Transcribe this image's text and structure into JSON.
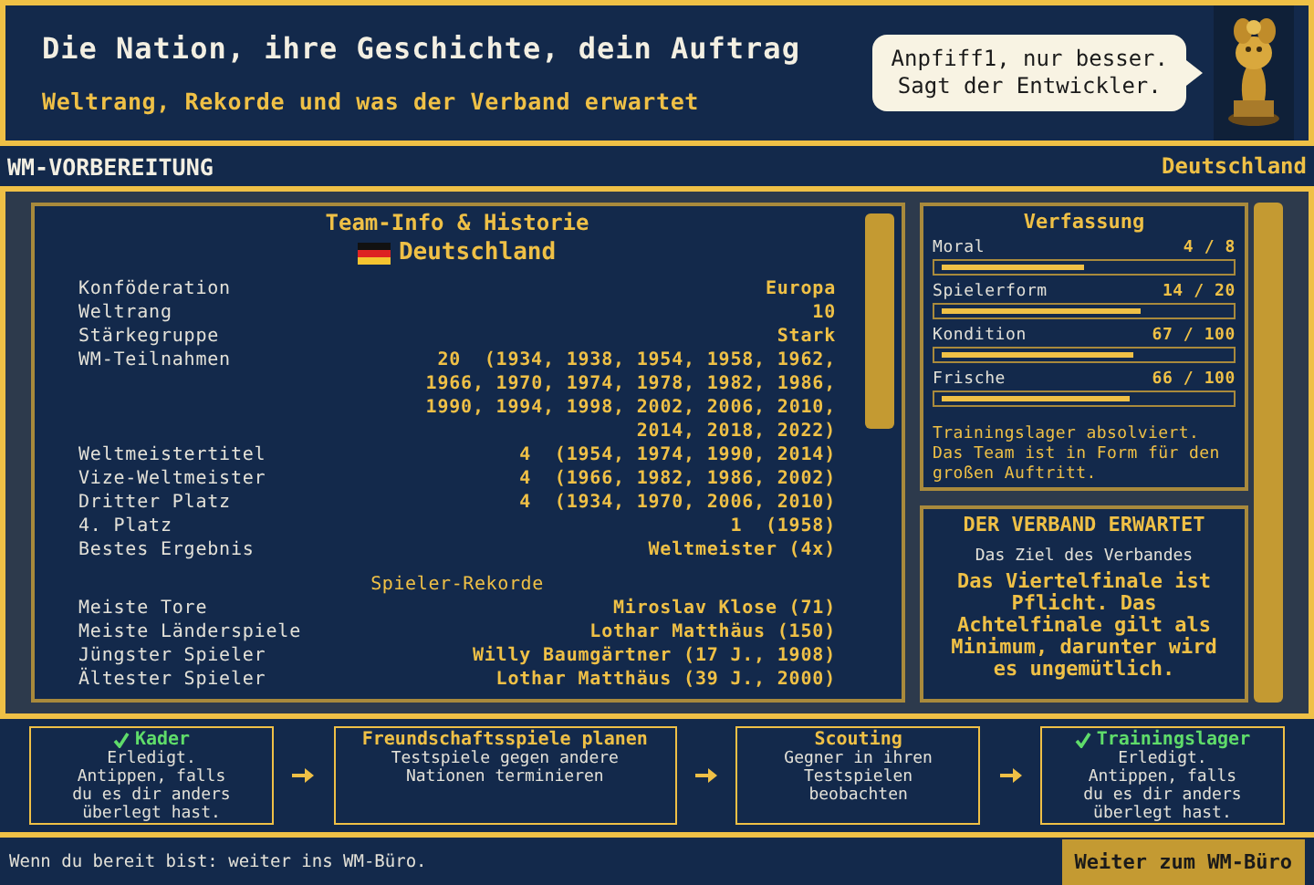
{
  "header": {
    "title": "Die Nation, ihre Geschichte, dein Auftrag",
    "subtitle": "Weltrang, Rekorde und was der Verband erwartet",
    "speech_bubble": "Anpfiff1, nur besser.\nSagt der Entwickler."
  },
  "title_bar": {
    "title": "WM-VORBEREITUNG",
    "country": "Deutschland"
  },
  "team_info": {
    "title": "Team-Info & Historie",
    "country": "Deutschland",
    "rows": [
      {
        "label": "Konföderation",
        "value": "Europa"
      },
      {
        "label": "Weltrang",
        "value": "10"
      },
      {
        "label": "Stärkegruppe",
        "value": "Stark"
      },
      {
        "label": "WM-Teilnahmen",
        "value": "20  (1934, 1938, 1954, 1958, 1962,\n1966, 1970, 1974, 1978, 1982, 1986,\n1990, 1994, 1998, 2002, 2006, 2010,\n2014, 2018, 2022)"
      },
      {
        "label": "Weltmeistertitel",
        "value": "4  (1954, 1974, 1990, 2014)"
      },
      {
        "label": "Vize-Weltmeister",
        "value": "4  (1966, 1982, 1986, 2002)"
      },
      {
        "label": "Dritter Platz",
        "value": "4  (1934, 1970, 2006, 2010)"
      },
      {
        "label": "4. Platz",
        "value": "1  (1958)"
      },
      {
        "label": "Bestes Ergebnis",
        "value": "Weltmeister (4x)"
      }
    ],
    "records_title": "Spieler-Rekorde",
    "records": [
      {
        "label": "Meiste Tore",
        "value": "Miroslav Klose (71)"
      },
      {
        "label": "Meiste Länderspiele",
        "value": "Lothar Matthäus (150)"
      },
      {
        "label": "Jüngster Spieler",
        "value": "Willy Baumgärtner (17 J., 1908)"
      },
      {
        "label": "Ältester Spieler",
        "value": "Lothar Matthäus (39 J., 2000)"
      }
    ]
  },
  "condition": {
    "title": "Verfassung",
    "meters": [
      {
        "name": "Moral",
        "reading": "4 / 8",
        "level": 0.5
      },
      {
        "name": "Spielerform",
        "reading": "14 / 20",
        "level": 0.7
      },
      {
        "name": "Kondition",
        "reading": "67 / 100",
        "level": 0.67
      },
      {
        "name": "Frische",
        "reading": "66 / 100",
        "level": 0.66
      }
    ],
    "note": "Trainingslager absolviert. Das Team ist in Form für den großen Auftritt."
  },
  "expectation": {
    "title": "DER VERBAND ERWARTET",
    "subtitle": "Das Ziel des Verbandes",
    "text": "Das Viertelfinale ist Pflicht. Das Achtelfinale gilt als Minimum, darunter wird es ungemütlich."
  },
  "steps": [
    {
      "title": "Kader",
      "text": "Erledigt.\nAntippen, falls\ndu es dir anders\nüberlegt hast.",
      "done": true
    },
    {
      "title": "Freundschaftsspiele planen",
      "text": "Testspiele gegen andere\nNationen terminieren",
      "done": false
    },
    {
      "title": "Scouting",
      "text": "Gegner in ihren\nTestspielen\nbeobachten",
      "done": false
    },
    {
      "title": "Trainingslager",
      "text": "Erledigt.\nAntippen, falls\ndu es dir anders\nüberlegt hast.",
      "done": true
    }
  ],
  "footer": {
    "hint": "Wenn du bereit bist: weiter ins WM-Büro.",
    "button": "Weiter zum WM-Büro"
  }
}
